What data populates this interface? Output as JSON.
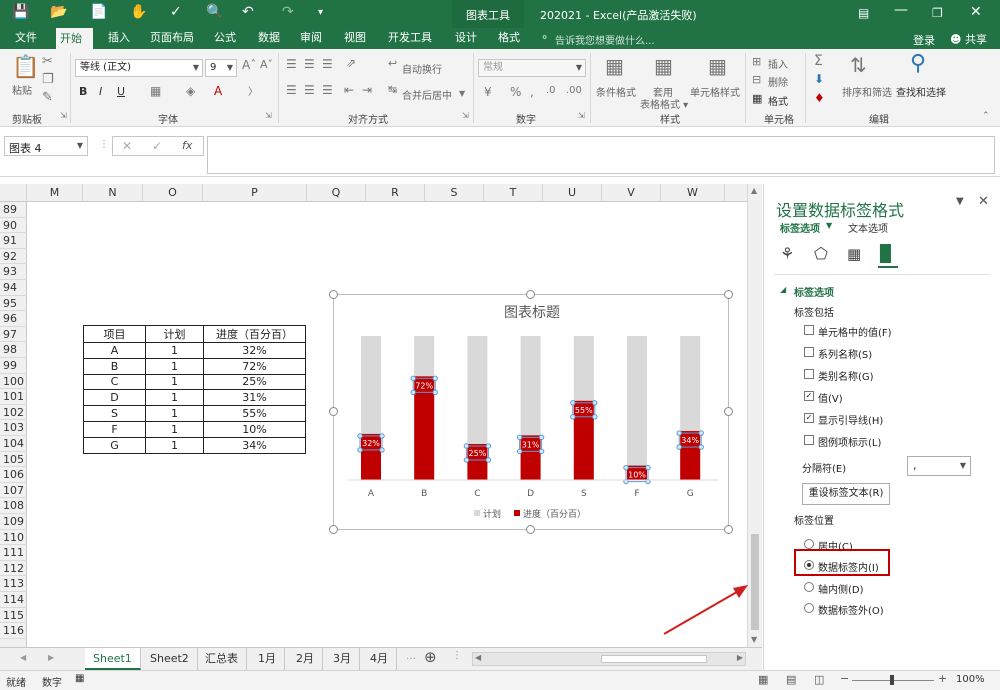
{
  "window": {
    "chart_tools": "图表工具",
    "title": "202021 - Excel(产品激活失败)",
    "login": "登录",
    "share": "共享"
  },
  "tabs": [
    "文件",
    "开始",
    "插入",
    "页面布局",
    "公式",
    "数据",
    "审阅",
    "视图",
    "开发工具",
    "设计",
    "格式"
  ],
  "tell_me": "告诉我您想要做什么...",
  "ribbon": {
    "paste": "粘贴",
    "clipboard": "剪贴板",
    "font_name": "等线 (正文)",
    "font_size": "9",
    "font": "字体",
    "wrap": "自动换行",
    "merge": "合并后居中",
    "align": "对齐方式",
    "num_format": "常规",
    "number": "数字",
    "cond_fmt": "条件格式",
    "table_fmt": "套用\n表格格式",
    "cell_style": "单元格样式",
    "styles": "样式",
    "insert": "插入",
    "delete": "删除",
    "format": "格式",
    "cells": "单元格",
    "sort": "排序和筛选",
    "find": "查找和选择",
    "edit": "编辑"
  },
  "formula_bar": {
    "name_box": "图表 4",
    "fx": "fx"
  },
  "columns": [
    "M",
    "N",
    "O",
    "P",
    "Q",
    "R",
    "S",
    "T",
    "U",
    "V",
    "W"
  ],
  "rows": [
    "89",
    "90",
    "91",
    "92",
    "93",
    "94",
    "95",
    "96",
    "97",
    "98",
    "99",
    "100",
    "101",
    "102",
    "103",
    "104",
    "105",
    "106",
    "107",
    "108",
    "109",
    "110",
    "111",
    "112",
    "113",
    "114",
    "115",
    "116"
  ],
  "table": {
    "headers": [
      "项目",
      "计划",
      "进度（百分百）"
    ],
    "rows": [
      [
        "A",
        "1",
        "32%"
      ],
      [
        "B",
        "1",
        "72%"
      ],
      [
        "C",
        "1",
        "25%"
      ],
      [
        "D",
        "1",
        "31%"
      ],
      [
        "S",
        "1",
        "55%"
      ],
      [
        "F",
        "1",
        "10%"
      ],
      [
        "G",
        "1",
        "34%"
      ]
    ]
  },
  "chart_data": {
    "type": "bar",
    "title": "图表标题",
    "categories": [
      "A",
      "B",
      "C",
      "D",
      "S",
      "F",
      "G"
    ],
    "series": [
      {
        "name": "计划",
        "values": [
          1,
          1,
          1,
          1,
          1,
          1,
          1
        ],
        "color": "#d9d9d9"
      },
      {
        "name": "进度（百分百）",
        "values": [
          0.32,
          0.72,
          0.25,
          0.31,
          0.55,
          0.1,
          0.34
        ],
        "color": "#c00000"
      }
    ],
    "data_labels": [
      "32%",
      "72%",
      "25%",
      "31%",
      "55%",
      "10%",
      "34%"
    ],
    "ylim": [
      0,
      1
    ],
    "legend": "bottom",
    "grid": false
  },
  "sheet_tabs": [
    "Sheet1",
    "Sheet2",
    "汇总表",
    "1月",
    "2月",
    "3月",
    "4月"
  ],
  "status": {
    "ready": "就绪",
    "mode": "数字",
    "zoom": "100%"
  },
  "pane": {
    "title": "设置数据标签格式",
    "tab_label_options": "标签选项",
    "tab_text_options": "文本选项",
    "section": "标签选项",
    "includes": "标签包括",
    "checks": [
      {
        "label": "单元格中的值(F)",
        "checked": false
      },
      {
        "label": "系列名称(S)",
        "checked": false
      },
      {
        "label": "类别名称(G)",
        "checked": false
      },
      {
        "label": "值(V)",
        "checked": true
      },
      {
        "label": "显示引导线(H)",
        "checked": true
      },
      {
        "label": "图例项标示(L)",
        "checked": false
      }
    ],
    "separator": "分隔符(E)",
    "separator_value": ",",
    "reset": "重设标签文本(R)",
    "position": "标签位置",
    "radios": [
      {
        "label": "居中(C)",
        "selected": false
      },
      {
        "label": "数据标签内(I)",
        "selected": true
      },
      {
        "label": "轴内侧(D)",
        "selected": false
      },
      {
        "label": "数据标签外(O)",
        "selected": false
      }
    ]
  },
  "colors": {
    "excel_green": "#217346",
    "highlight": "#c00000",
    "arrow": "#d0201e"
  }
}
